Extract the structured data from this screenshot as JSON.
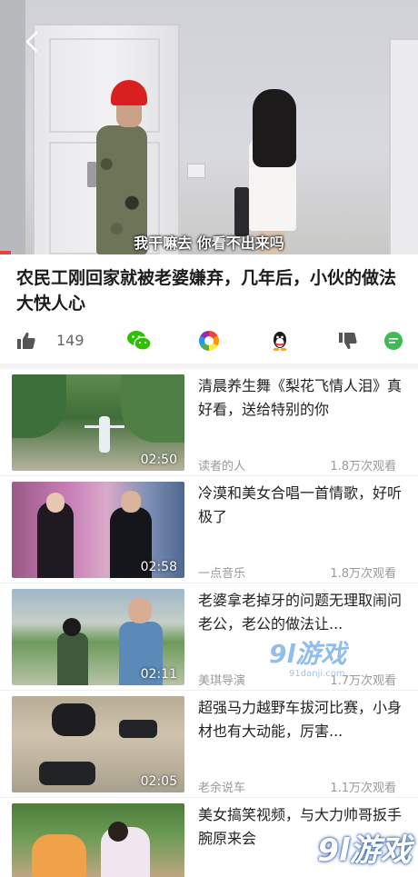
{
  "player": {
    "subtitle": "我干嘛去 你看不出来吗"
  },
  "video": {
    "title": "农民工刚回家就被老婆嫌弃，几年后，小伙的做法大快人心",
    "likes": "149"
  },
  "actions": {
    "icons": [
      "thumbs-up-icon",
      "wechat-icon",
      "moments-icon",
      "qq-icon",
      "thumbs-down-icon",
      "comment-icon"
    ],
    "colors": {
      "wechat": "#2dc100",
      "comment": "#3dbb57",
      "dark": "#444444"
    }
  },
  "list": [
    {
      "title": "清晨养生舞《梨花飞情人泪》真好看，送给特别的你",
      "source": "读者的人",
      "views": "1.8万次观看",
      "duration": "02:50"
    },
    {
      "title": "冷漠和美女合唱一首情歌，好听极了",
      "source": "一点音乐",
      "views": "1.8万次观看",
      "duration": "02:58"
    },
    {
      "title": "老婆拿老掉牙的问题无理取闹问老公，老公的做法让...",
      "source": "美琪导演",
      "views": "1.7万次观看",
      "duration": "02:11"
    },
    {
      "title": "超强马力越野车拔河比赛，小身材也有大动能，厉害...",
      "source": "老余说车",
      "views": "1.1万次观看",
      "duration": "02:05"
    },
    {
      "title": "美女搞笑视频，与大力帅哥扳手腕原来会",
      "source": "",
      "views": "",
      "duration": ""
    }
  ],
  "watermark": {
    "mark_small": "9l游戏",
    "domain_small": "91danji.com",
    "mark_large": "9l游戏"
  }
}
